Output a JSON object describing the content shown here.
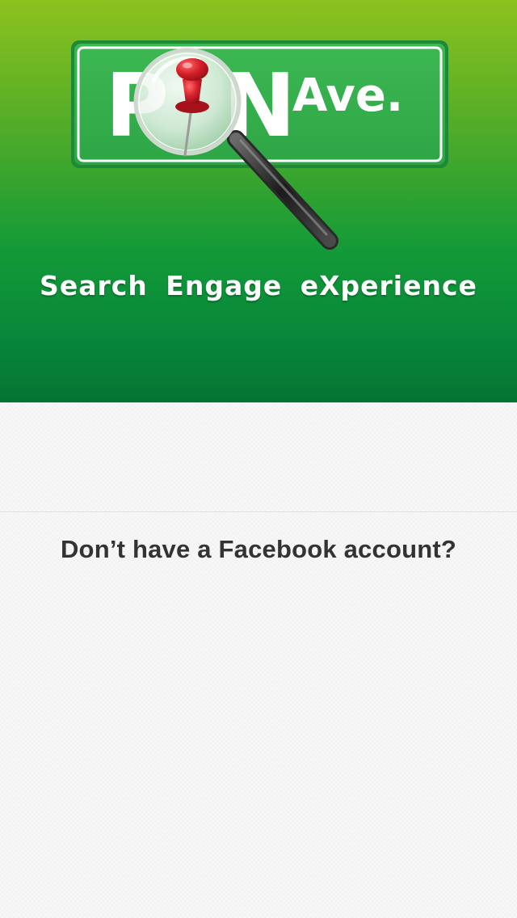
{
  "brand": {
    "logo_letters": [
      "P",
      "N"
    ],
    "logo_suffix": "Ave.",
    "tagline": "Search  Engage  eXperience",
    "colors": {
      "gradient_top": "#8dc21f",
      "gradient_bottom": "#057434",
      "sign_green": "#36b04b",
      "pin_red": "#d6202a"
    },
    "icons": [
      "magnifying-glass-icon",
      "push-pin-icon"
    ]
  },
  "signup": {
    "question": "Don’t have a Facebook account?"
  }
}
